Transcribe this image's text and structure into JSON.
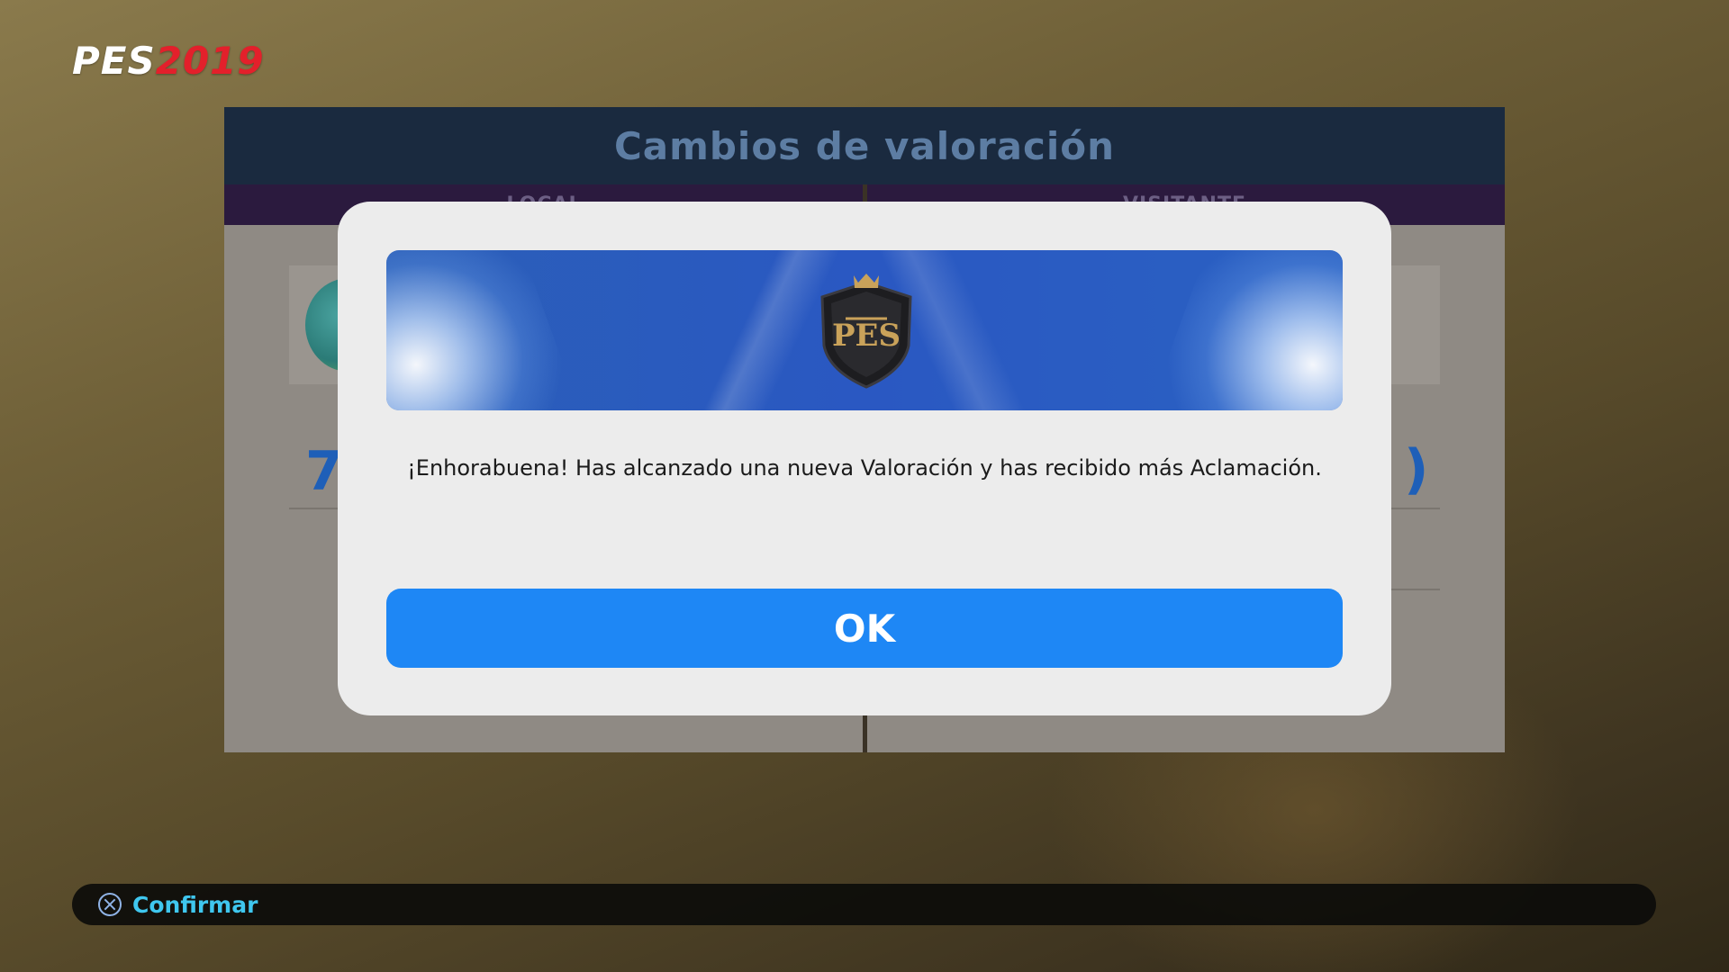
{
  "brand": {
    "pes": "PES",
    "year": "2019"
  },
  "panel": {
    "title": "Cambios de valoración",
    "home_label": "LOCAL",
    "away_label": "VISITANTE",
    "home_rating_partial": "7",
    "away_rating_partial": ")"
  },
  "modal": {
    "message": "¡Enhorabuena! Has alcanzado una nueva Valoración y has recibido más Aclamación.",
    "ok_label": "OK",
    "crest_icon": "pes-shield-crest-icon"
  },
  "footer": {
    "confirm_icon": "cross-button-icon",
    "confirm_label": "Confirmar"
  },
  "colors": {
    "accent_blue": "#1e87f5",
    "brand_red": "#e3202b",
    "footer_text": "#3fc7ef"
  }
}
